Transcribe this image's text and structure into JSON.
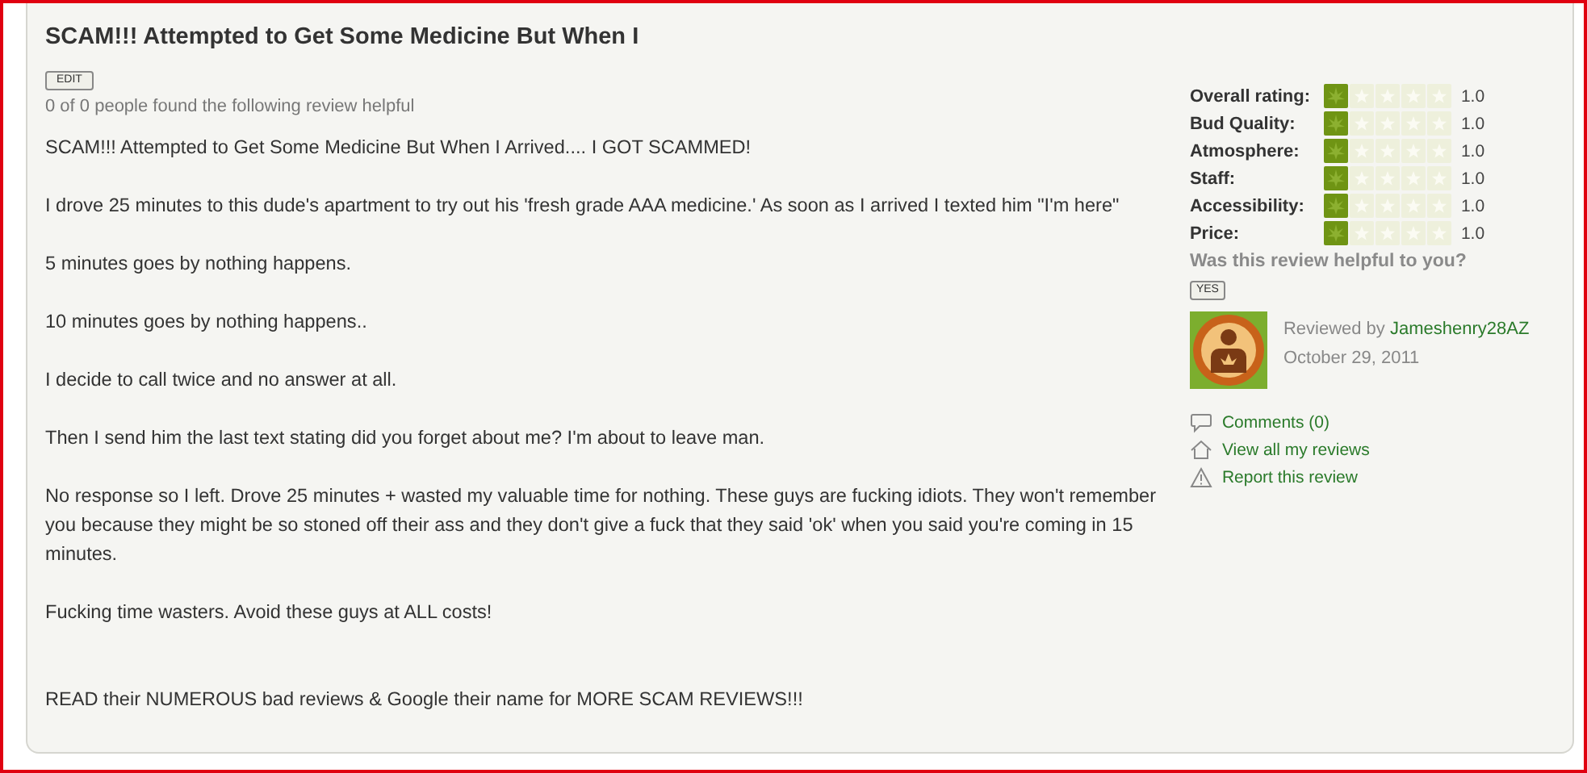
{
  "review": {
    "title": "SCAM!!! Attempted to Get Some Medicine But When I",
    "edit_button": "EDIT",
    "helpful_count": "0 of 0 people found the following review helpful",
    "paragraphs": [
      "SCAM!!! Attempted to Get Some Medicine But When I Arrived.... I GOT SCAMMED!",
      "I drove 25 minutes to this dude's apartment to try out his 'fresh grade AAA medicine.' As soon as I arrived I texted him \"I'm here\"",
      "5 minutes goes by nothing happens.",
      "10 minutes goes by nothing happens..",
      "I decide to call twice and no answer at all.",
      "Then I send him the last text stating did you forget about me? I'm about to leave man.",
      "No response so I left. Drove 25 minutes + wasted my valuable time for nothing. These guys are fucking idiots. They won't remember you because they might be so stoned off their ass and they don't give a fuck that they said 'ok' when you said you're coming in 15 minutes.",
      "Fucking time wasters. Avoid these guys at ALL costs!",
      "READ their NUMEROUS bad reviews & Google their name for MORE SCAM REVIEWS!!!"
    ]
  },
  "ratings": [
    {
      "label": "Overall rating:",
      "stars": 1,
      "value": "1.0"
    },
    {
      "label": "Bud Quality:",
      "stars": 1,
      "value": "1.0"
    },
    {
      "label": "Atmosphere:",
      "stars": 1,
      "value": "1.0"
    },
    {
      "label": "Staff:",
      "stars": 1,
      "value": "1.0"
    },
    {
      "label": "Accessibility:",
      "stars": 1,
      "value": "1.0"
    },
    {
      "label": "Price:",
      "stars": 1,
      "value": "1.0"
    }
  ],
  "helpful_prompt": "Was this review helpful to you?",
  "yes_button": "YES",
  "reviewer": {
    "prefix": "Reviewed by",
    "name": "Jameshenry28AZ",
    "date": "October 29, 2011"
  },
  "links": [
    {
      "kind": "comment",
      "label": "Comments (0)"
    },
    {
      "kind": "home",
      "label": "View all my reviews"
    },
    {
      "kind": "warning",
      "label": "Report this review"
    }
  ]
}
